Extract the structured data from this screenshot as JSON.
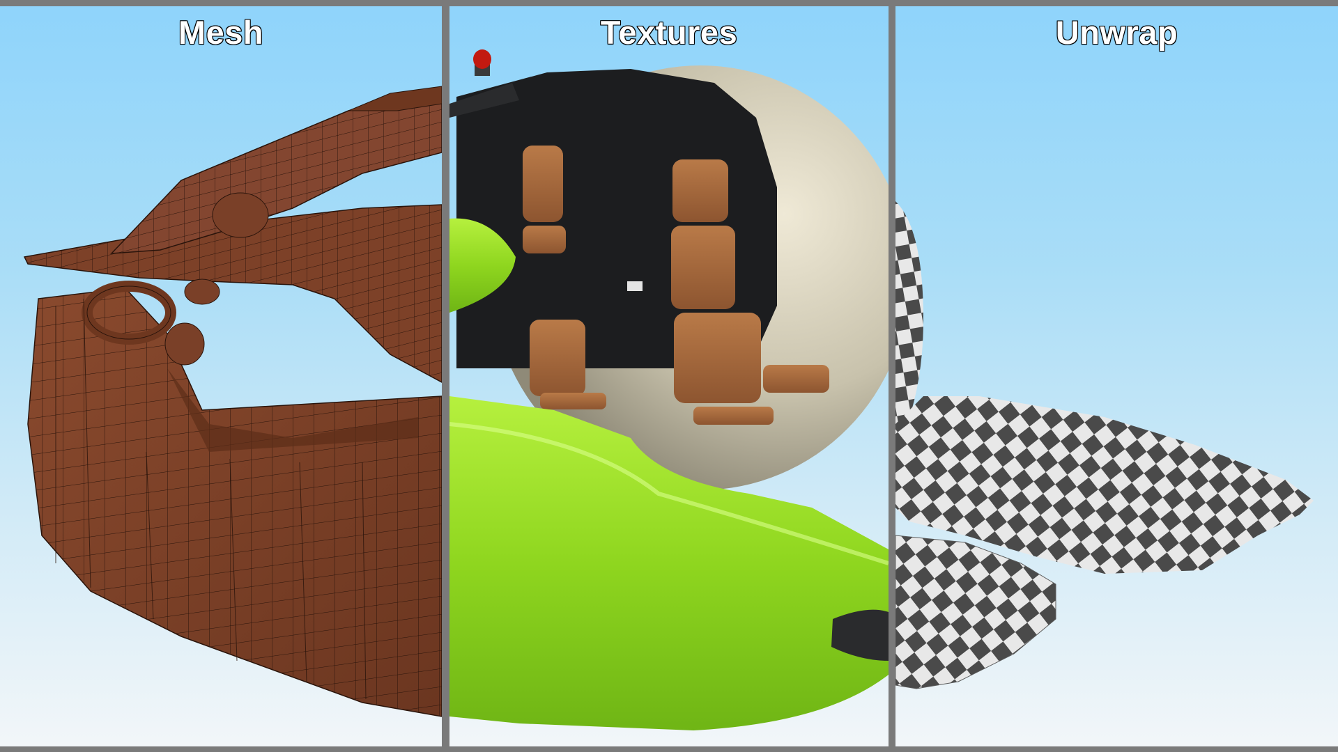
{
  "panels": [
    {
      "title": "Mesh"
    },
    {
      "title": "Textures"
    },
    {
      "title": "Unwrap"
    }
  ],
  "colors": {
    "mesh_clay": "#7a4028",
    "mesh_wire": "#2a140b",
    "hull_green": "#8bd41e",
    "hull_green_light": "#b6f03e",
    "seat_leather": "#a4673c",
    "cabin_dark": "#1c1d1f",
    "dome_glass": "#d8d2bc",
    "checker_dark": "#4a4a4a",
    "checker_light": "#e8e8e8",
    "beacon_red": "#c21a10",
    "sky_top": "#8fd4fb",
    "sky_bottom": "#f2f6f9",
    "divider": "#7a7a7a"
  }
}
